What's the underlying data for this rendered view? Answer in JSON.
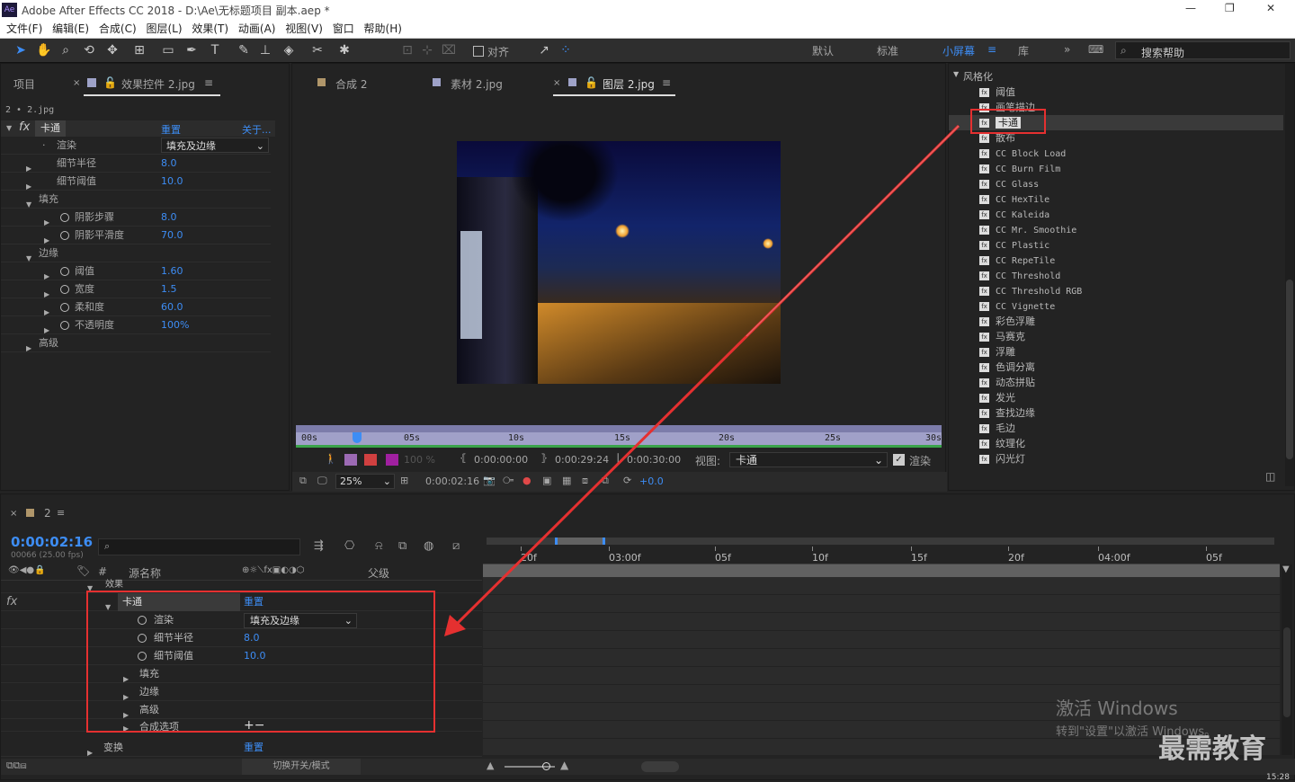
{
  "titlebar": {
    "app_icon": "Ae",
    "title": "Adobe After Effects CC 2018 - D:\\Ae\\无标题项目 副本.aep *",
    "min": "—",
    "max": "❐",
    "close": "✕"
  },
  "menu": [
    "文件(F)",
    "编辑(E)",
    "合成(C)",
    "图层(L)",
    "效果(T)",
    "动画(A)",
    "视图(V)",
    "窗口",
    "帮助(H)"
  ],
  "toolbar": {
    "align_label": "对齐",
    "workspaces": [
      "默认",
      "标准",
      "小屏幕",
      "库"
    ],
    "active_workspace": "小屏幕",
    "search_placeholder": "搜索帮助"
  },
  "left_panel": {
    "tab_project": "项目",
    "tab_effects": "效果控件 2.jpg",
    "layer_label": "2 • 2.jpg",
    "effect_name": "卡通",
    "reset": "重置",
    "about": "关于...",
    "rows": [
      {
        "label": "渲染",
        "value": "填充及边缘",
        "kind": "select"
      },
      {
        "label": "细节半径",
        "value": "8.0"
      },
      {
        "label": "细节阈值",
        "value": "10.0"
      },
      {
        "label": "填充",
        "value": ""
      },
      {
        "label": "阴影步骤",
        "value": "8.0"
      },
      {
        "label": "阴影平滑度",
        "value": "70.0"
      },
      {
        "label": "边缘",
        "value": ""
      },
      {
        "label": "阈值",
        "value": "1.60"
      },
      {
        "label": "宽度",
        "value": "1.5"
      },
      {
        "label": "柔和度",
        "value": "60.0"
      },
      {
        "label": "不透明度",
        "value": "100%"
      },
      {
        "label": "高级",
        "value": ""
      }
    ]
  },
  "viewer": {
    "tabs": [
      "合成 2",
      "素材 2.jpg",
      "图层 2.jpg"
    ],
    "ruler": [
      "00s",
      "05s",
      "10s",
      "15s",
      "20s",
      "25s",
      "30s"
    ],
    "time_in": "0:00:00:00",
    "time_out": "0:00:29:24",
    "duration": "0:00:30:00",
    "view_label": "视图:",
    "view_value": "卡通",
    "render_label": "渲染",
    "opacity": "100 %",
    "zoom": "25%",
    "timecode": "0:00:02:16",
    "exposure": "+0.0"
  },
  "effects_panel": {
    "category": "风格化",
    "items": [
      "阈值",
      "画笔描边",
      "卡通",
      "散布",
      "CC Block Load",
      "CC Burn Film",
      "CC Glass",
      "CC HexTile",
      "CC Kaleida",
      "CC Mr. Smoothie",
      "CC Plastic",
      "CC RepeTile",
      "CC Threshold",
      "CC Threshold RGB",
      "CC Vignette",
      "彩色浮雕",
      "马赛克",
      "浮雕",
      "色调分离",
      "动态拼贴",
      "发光",
      "查找边缘",
      "毛边",
      "纹理化",
      "闪光灯"
    ],
    "selected": "卡通"
  },
  "timeline": {
    "tab_name": "2",
    "timecode": "0:00:02:16",
    "fps": "00066 (25.00 fps)",
    "col_source": "源名称",
    "col_parent": "父级",
    "effects_group": "效果",
    "effect_name": "卡通",
    "reset": "重置",
    "render_label": "渲染",
    "render_value": "填充及边缘",
    "radius_label": "细节半径",
    "radius_value": "8.0",
    "thresh_label": "细节阈值",
    "thresh_value": "10.0",
    "fill": "填充",
    "edge": "边缘",
    "advanced": "高级",
    "compose": "合成选项",
    "transform": "变换",
    "transform_reset": "重置",
    "toggle_label": "切换开关/模式",
    "ruler": [
      "20f",
      "03:00f",
      "05f",
      "10f",
      "15f",
      "20f",
      "04:00f",
      "05f"
    ]
  },
  "watermark": {
    "line1": "激活 Windows",
    "line2": "转到\"设置\"以激活 Windows。",
    "brand": "最需教育",
    "clock": "15:28"
  },
  "colors": {
    "accent": "#3d8df5",
    "highlight_box": "#e53030",
    "arrow": "#e53030"
  }
}
